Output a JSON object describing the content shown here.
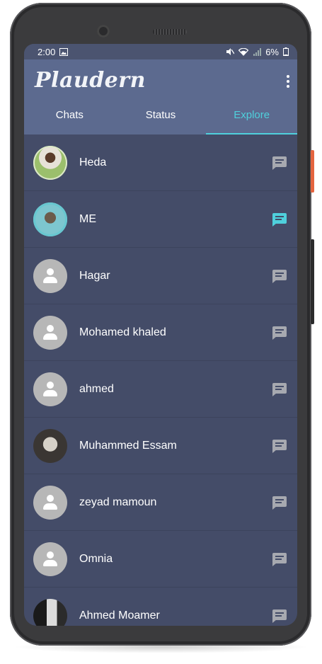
{
  "status_bar": {
    "time": "2:00",
    "battery": "6%"
  },
  "app": {
    "title": "Plaudern"
  },
  "tabs": [
    {
      "label": "Chats",
      "active": false
    },
    {
      "label": "Status",
      "active": false
    },
    {
      "label": "Explore",
      "active": true
    }
  ],
  "contacts": [
    {
      "name": "Heda",
      "avatar": "photo"
    },
    {
      "name": "ME",
      "avatar": "photo"
    },
    {
      "name": "Hagar",
      "avatar": "default"
    },
    {
      "name": "Mohamed khaled",
      "avatar": "default"
    },
    {
      "name": "ahmed",
      "avatar": "default"
    },
    {
      "name": "Muhammed Essam",
      "avatar": "photo"
    },
    {
      "name": "zeyad mamoun",
      "avatar": "default"
    },
    {
      "name": "Omnia",
      "avatar": "default"
    },
    {
      "name": "Ahmed Moamer",
      "avatar": "photo"
    }
  ],
  "colors": {
    "accent": "#4fd0dc",
    "appbar": "#5c6a8f",
    "background": "#444c68"
  }
}
